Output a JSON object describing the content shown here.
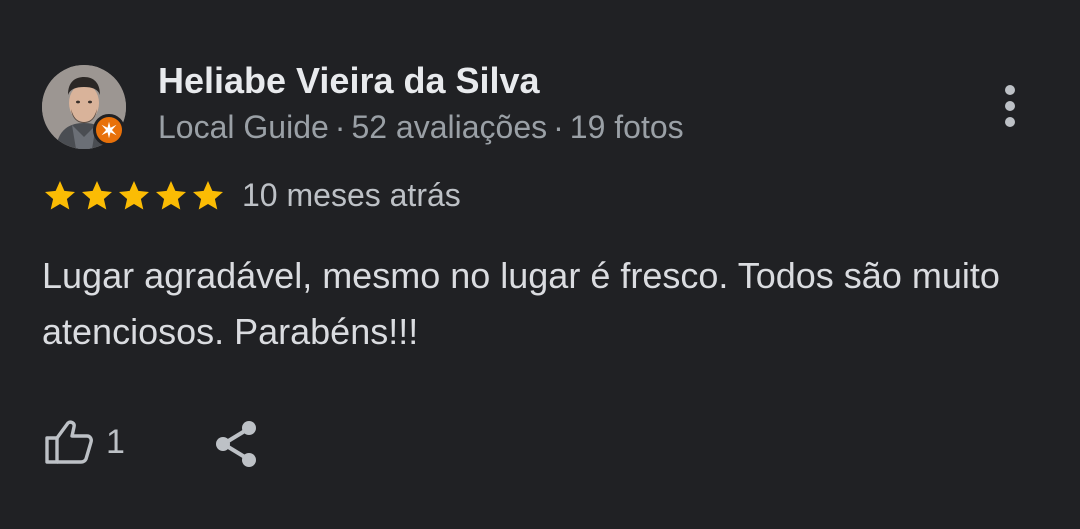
{
  "reviewer": {
    "name": "Heliabe Vieira da Silva",
    "role": "Local Guide",
    "reviews": "52 avaliações",
    "photos": "19 fotos",
    "separator": "·",
    "avatar_icon": "person-photo",
    "badge_icon": "local-guide-star-icon",
    "badge_color": "#e8710a"
  },
  "review": {
    "rating": 5,
    "max_rating": 5,
    "star_color": "#fbbc04",
    "date": "10 meses atrás",
    "text": "Lugar agradável, mesmo no lugar é fresco. Todos são muito atenciosos. Parabéns!!!"
  },
  "actions": {
    "like_icon": "thumb-up-icon",
    "like_count": "1",
    "share_icon": "share-icon",
    "more_icon": "more-vert-icon"
  }
}
